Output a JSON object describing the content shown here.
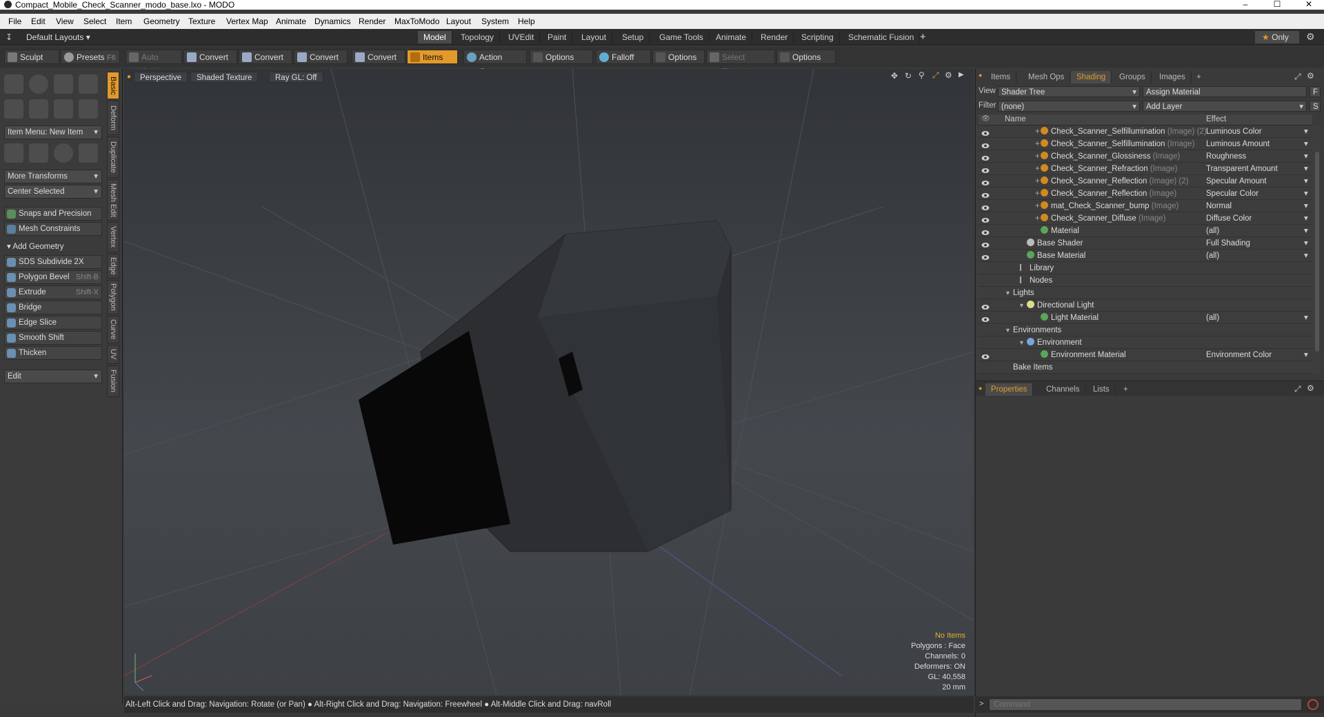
{
  "window": {
    "title": "Compact_Mobile_Check_Scanner_modo_base.lxo - MODO",
    "minimize": "–",
    "maximize": "☐",
    "close": "✕"
  },
  "menu": [
    "File",
    "Edit",
    "View",
    "Select",
    "Item",
    "Geometry",
    "Texture",
    "Vertex Map",
    "Animate",
    "Dynamics",
    "Render",
    "MaxToModo",
    "Layout",
    "System",
    "Help"
  ],
  "layoutbar": {
    "layouts_label": "Default Layouts",
    "tabs": [
      "Model",
      "Topology",
      "UVEdit",
      "Paint",
      "Layout",
      "Setup",
      "Game Tools",
      "Animate",
      "Render",
      "Scripting",
      "Schematic Fusion"
    ],
    "active_tab": "Model",
    "add": "+",
    "only": "Only"
  },
  "toolbar": {
    "sculpt": "Sculpt",
    "presets": "Presets",
    "presets_key": "F6",
    "auto_select": "Auto Select",
    "convert": "Convert",
    "items": "Items",
    "action_center": "Action Center",
    "options": "Options",
    "falloff": "Falloff",
    "select_through": "Select Through"
  },
  "left": {
    "item_menu": "Item Menu: New Item",
    "more_transforms": "More Transforms",
    "center_selected": "Center Selected",
    "snaps": "Snaps and Precision",
    "mesh_constraints": "Mesh Constraints",
    "add_geometry": "Add Geometry",
    "tools": [
      {
        "label": "SDS Subdivide 2X",
        "key": ""
      },
      {
        "label": "Polygon Bevel",
        "key": "Shift-B"
      },
      {
        "label": "Extrude",
        "key": "Shift-X"
      },
      {
        "label": "Bridge",
        "key": ""
      },
      {
        "label": "Edge Slice",
        "key": ""
      },
      {
        "label": "Smooth Shift",
        "key": ""
      },
      {
        "label": "Thicken",
        "key": ""
      }
    ],
    "edit": "Edit",
    "vtabs": [
      "Basic",
      "Deform",
      "Duplicate",
      "Mesh Edit",
      "Vertex",
      "Edge",
      "Polygon",
      "Curve",
      "UV",
      "Fusion"
    ]
  },
  "viewport": {
    "perspective": "Perspective",
    "shading": "Shaded Texture",
    "raygl": "Ray GL: Off",
    "info": {
      "no_items": "No Items",
      "polygons": "Polygons : Face",
      "channels": "Channels: 0",
      "deformers": "Deformers: ON",
      "gl": "GL: 40,558",
      "unit": "20 mm"
    }
  },
  "status": "Alt-Left Click and Drag: Navigation: Rotate (or Pan) ●  Alt-Right Click and Drag: Navigation: Freewheel ●  Alt-Middle Click and Drag: navRoll",
  "right": {
    "tabs": [
      "Items",
      "Mesh Ops",
      "Shading",
      "Groups",
      "Images",
      "+"
    ],
    "active_tab": "Shading",
    "view_label": "View",
    "view_value": "Shader Tree",
    "assign": "Assign Material",
    "f_btn": "F",
    "filter_label": "Filter",
    "filter_value": "(none)",
    "add_layer": "Add Layer",
    "s_btn": "S",
    "col_name": "Name",
    "col_effect": "Effect",
    "rows": [
      {
        "name": "Check_Scanner_Selfillumination",
        "sub": "(Image) (2)",
        "effect": "Luminous Color",
        "indent": 60,
        "eye": true,
        "type": "img",
        "plus": true
      },
      {
        "name": "Check_Scanner_Selfillumination",
        "sub": "(Image)",
        "effect": "Luminous Amount",
        "indent": 60,
        "eye": true,
        "type": "img",
        "plus": true
      },
      {
        "name": "Check_Scanner_Glossiness",
        "sub": "(Image)",
        "effect": "Roughness",
        "indent": 60,
        "eye": true,
        "type": "img",
        "plus": true
      },
      {
        "name": "Check_Scanner_Refraction",
        "sub": "(Image)",
        "effect": "Transparent Amount",
        "indent": 60,
        "eye": true,
        "type": "img",
        "plus": true
      },
      {
        "name": "Check_Scanner_Reflection",
        "sub": "(Image) (2)",
        "effect": "Specular Amount",
        "indent": 60,
        "eye": true,
        "type": "img",
        "plus": true
      },
      {
        "name": "Check_Scanner_Reflection",
        "sub": "(Image)",
        "effect": "Specular Color",
        "indent": 60,
        "eye": true,
        "type": "img",
        "plus": true
      },
      {
        "name": "mat_Check_Scanner_bump",
        "sub": "(Image)",
        "effect": "Normal",
        "indent": 60,
        "eye": true,
        "type": "img",
        "plus": true
      },
      {
        "name": "Check_Scanner_Diffuse",
        "sub": "(Image)",
        "effect": "Diffuse Color",
        "indent": 60,
        "eye": true,
        "type": "img",
        "plus": true
      },
      {
        "name": "Material",
        "sub": "",
        "effect": "(all)",
        "indent": 60,
        "eye": true,
        "type": "mat",
        "plus": false
      },
      {
        "name": "Base Shader",
        "sub": "",
        "effect": "Full Shading",
        "indent": 40,
        "eye": true,
        "type": "shader",
        "plus": false
      },
      {
        "name": "Base Material",
        "sub": "",
        "effect": "(all)",
        "indent": 40,
        "eye": true,
        "type": "mat",
        "plus": false
      },
      {
        "name": "Library",
        "sub": "",
        "effect": "",
        "indent": 30,
        "eye": false,
        "type": "folder",
        "plus": false
      },
      {
        "name": "Nodes",
        "sub": "",
        "effect": "",
        "indent": 30,
        "eye": false,
        "type": "folder",
        "plus": false
      },
      {
        "name": "Lights",
        "sub": "",
        "effect": "",
        "indent": 20,
        "eye": false,
        "type": "none",
        "plus": false,
        "caret": true
      },
      {
        "name": "Directional Light",
        "sub": "",
        "effect": "",
        "indent": 40,
        "eye": true,
        "type": "light",
        "plus": false,
        "caret": true
      },
      {
        "name": "Light Material",
        "sub": "",
        "effect": "(all)",
        "indent": 60,
        "eye": true,
        "type": "mat",
        "plus": false
      },
      {
        "name": "Environments",
        "sub": "",
        "effect": "",
        "indent": 20,
        "eye": false,
        "type": "none",
        "plus": false,
        "caret": true
      },
      {
        "name": "Environment",
        "sub": "",
        "effect": "",
        "indent": 40,
        "eye": false,
        "type": "env",
        "plus": false,
        "caret": true
      },
      {
        "name": "Environment Material",
        "sub": "",
        "effect": "Environment Color",
        "indent": 60,
        "eye": true,
        "type": "mat",
        "plus": false
      },
      {
        "name": "Bake Items",
        "sub": "",
        "effect": "",
        "indent": 20,
        "eye": false,
        "type": "none",
        "plus": false
      }
    ],
    "lower_tabs": [
      "Properties",
      "Channels",
      "Lists",
      "+"
    ],
    "lower_active": "Properties",
    "command_placeholder": "Command"
  },
  "colors": {
    "accent": "#e39a2a",
    "image_layer": "#d08a20",
    "material": "#5aa55a"
  }
}
